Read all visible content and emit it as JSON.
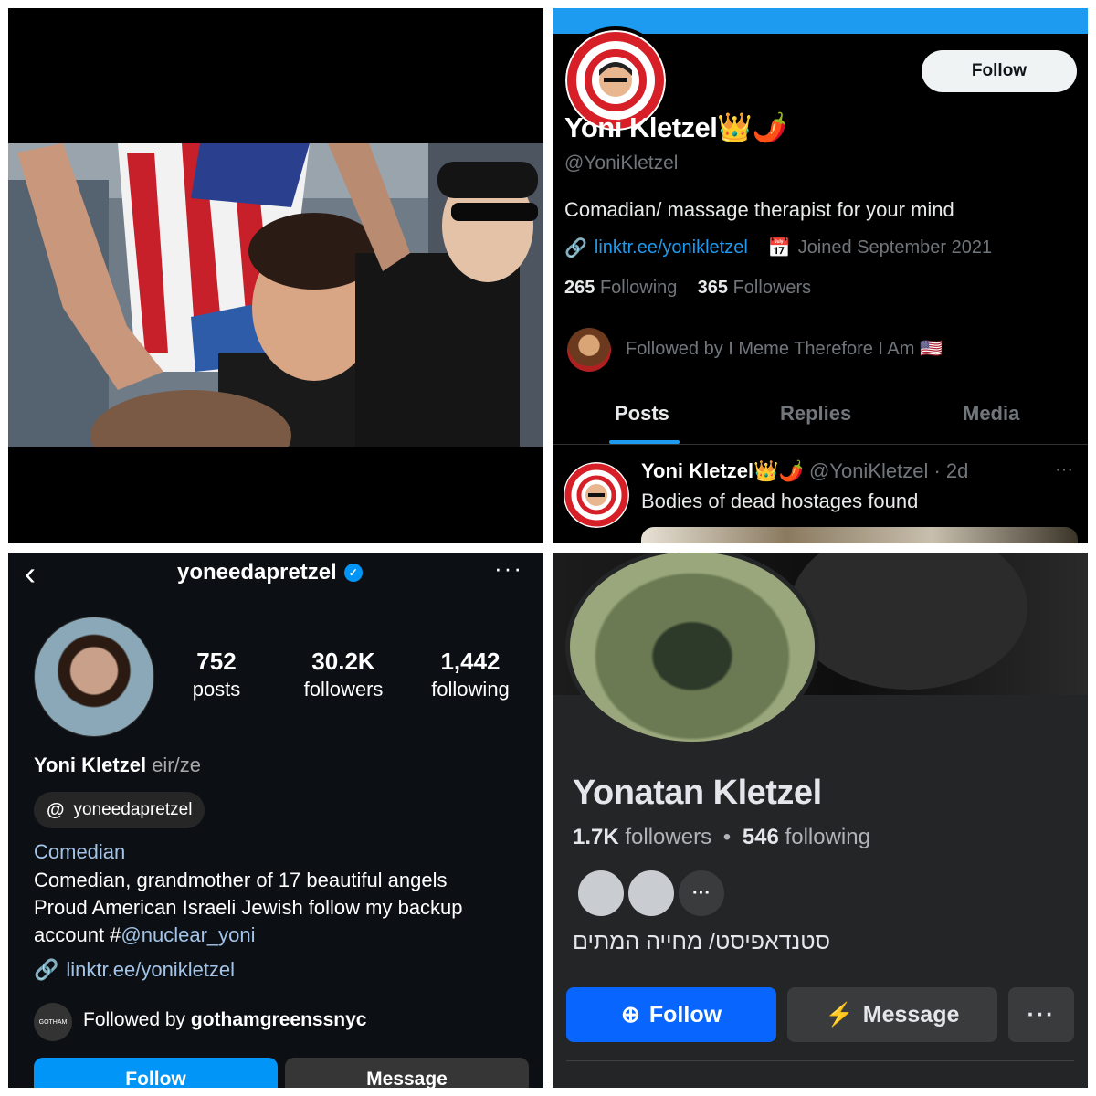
{
  "x_profile": {
    "follow_label": "Follow",
    "name": "Yoni Kletzel👑🌶️",
    "handle": "@YoniKletzel",
    "bio": "Comadian/ massage therapist for your mind",
    "link": "linktr.ee/yonikletzel",
    "joined": "Joined September 2021",
    "following_count": "265",
    "following_label": "Following",
    "followers_count": "365",
    "followers_label": "Followers",
    "followed_by": "Followed by I Meme Therefore I Am 🇺🇸",
    "tabs": [
      "Posts",
      "Replies",
      "Media"
    ],
    "active_tab": "Posts",
    "post": {
      "name": "Yoni Kletzel👑🌶️",
      "handle_time": "@YoniKletzel · 2d",
      "text": "Bodies of dead hostages found",
      "more": "···"
    },
    "accent": "#1d9bf0"
  },
  "instagram_profile": {
    "username": "yoneedapretzel",
    "verified": true,
    "stats": [
      {
        "num": "752",
        "label": "posts"
      },
      {
        "num": "30.2K",
        "label": "followers"
      },
      {
        "num": "1,442",
        "label": "following"
      }
    ],
    "name": "Yoni Kletzel",
    "pronouns": "eir/ze",
    "threads_handle": "yoneedapretzel",
    "category": "Comedian",
    "bio_line1": "Comedian, grandmother of 17 beautiful angels",
    "bio_line2": "Proud American Israeli Jewish follow my backup account #",
    "bio_mention": "@nuclear_yoni",
    "link": "linktr.ee/yonikletzel",
    "followed_by_prefix": "Followed by ",
    "followed_by_user": "gothamgreenssnyc",
    "follow_label": "Follow",
    "message_label": "Message",
    "accent": "#0095f6"
  },
  "facebook_profile": {
    "name": "Yonatan Kletzel",
    "followers_count": "1.7K",
    "followers_label": "followers",
    "separator": "•",
    "following_count": "546",
    "following_label": "following",
    "bio": "סטנדאפיסט/ מחייה המתים",
    "follow_label": "Follow",
    "message_label": "Message",
    "more_label": "···",
    "accent": "#0866ff"
  },
  "icons": [
    "link-icon",
    "calendar-icon",
    "back-chevron-icon",
    "verified-badge-icon",
    "more-icon",
    "threads-icon",
    "messenger-icon",
    "add-friend-icon"
  ]
}
